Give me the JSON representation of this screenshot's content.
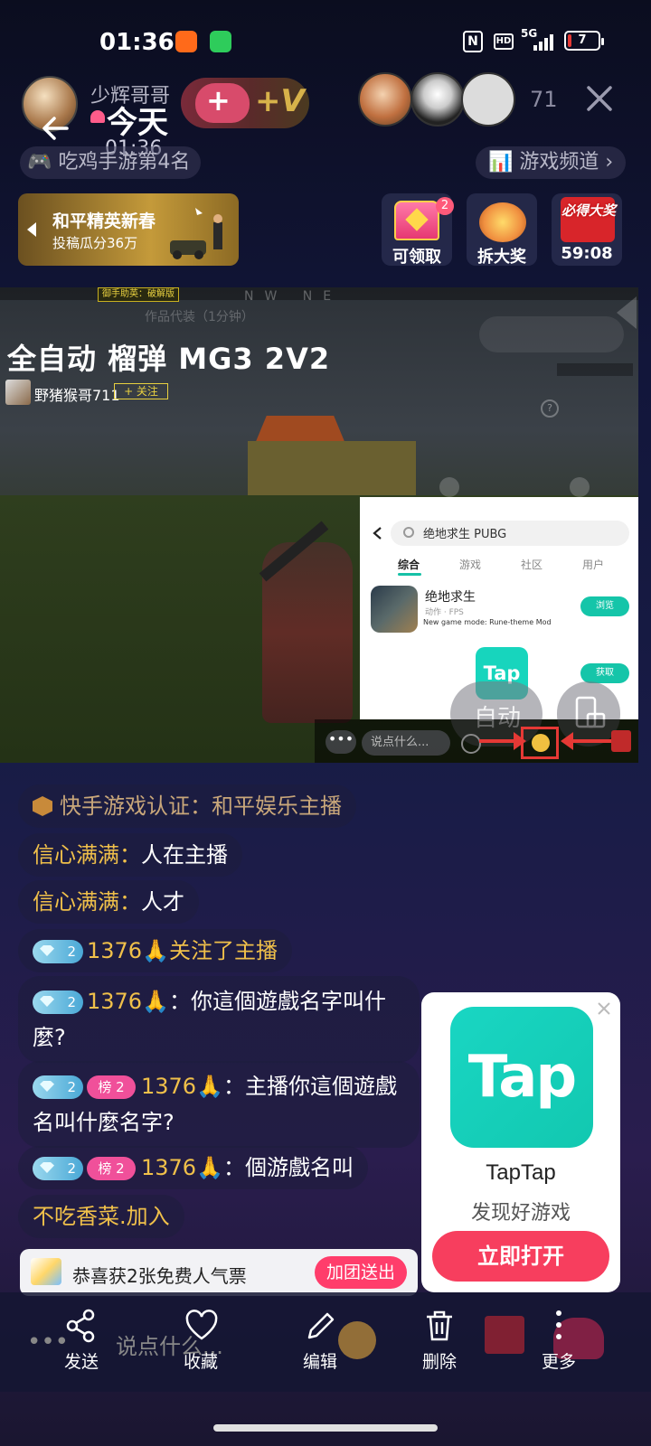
{
  "status_bar": {
    "time": "01:36",
    "network": "5G",
    "hd": "HD",
    "battery": "7",
    "nfc": "N"
  },
  "header": {
    "host_name": "少辉哥哥",
    "title": "今天",
    "subtitle_time": "01:36",
    "viewer_count": "71",
    "heart_plus": "+",
    "v_plus": "+V"
  },
  "tags": {
    "left": "吃鸡手游第4名",
    "right": "游戏频道"
  },
  "promo": {
    "title": "和平精英新春",
    "subtitle": "投稿瓜分36万"
  },
  "gifts": [
    {
      "label": "可领取",
      "badge": "2"
    },
    {
      "label": "拆大奖"
    },
    {
      "label": "59:08",
      "top_text": "必得大奖"
    }
  ],
  "video": {
    "title": "全自动 榴弹 MG3 2V2",
    "streamer": "野猪猴哥711",
    "follow": "+ 关注",
    "hud_tag": "御手助英：破解版",
    "hud_faint": "作品代装（1分钟）",
    "compass": "NW NE"
  },
  "pip": {
    "search_text": "绝地求生 PUBG",
    "tabs": [
      "综合",
      "游戏",
      "社区",
      "用户"
    ],
    "app_name": "绝地求生",
    "app_category": "动作 · FPS",
    "app_desc": "New game mode: Rune-theme Mod",
    "btn_browse": "浏览",
    "btn_get": "获取",
    "tap_label": "Tap"
  },
  "overlay": {
    "auto_label": "自动",
    "input_placeholder": "说点什么...",
    "dots": "•••"
  },
  "chat": {
    "system": "快手游戏认证：和平娱乐主播",
    "lines": [
      {
        "name": "信心满满：",
        "text": "人在主播"
      },
      {
        "name": "信心满满：",
        "text": "人才"
      },
      {
        "level": "2",
        "name": "1376🙏",
        "text": "关注了主播"
      },
      {
        "level": "2",
        "name": "1376🙏",
        "text": "：你這個遊戲名字叫什麼?"
      },
      {
        "level": "2",
        "rank": "榜 2",
        "name": "1376🙏",
        "text": "：主播你這個遊戲名叫什麼名字?"
      },
      {
        "level": "2",
        "rank": "榜 2",
        "name": "1376🙏",
        "text": "：個游戲名叫"
      },
      {
        "name": "不吃香菜.加入"
      }
    ]
  },
  "ad": {
    "icon_text": "Tap",
    "name": "TapTap",
    "subtitle": "发现好游戏",
    "button": "立即打开"
  },
  "ticket": {
    "text": "恭喜获2张免费人气票",
    "button": "加团送出"
  },
  "under_bar": {
    "dots": "•••",
    "placeholder": "说点什么..."
  },
  "actions": [
    {
      "label": "发送",
      "icon": "share-icon"
    },
    {
      "label": "收藏",
      "icon": "heart-icon"
    },
    {
      "label": "编辑",
      "icon": "pencil-icon"
    },
    {
      "label": "删除",
      "icon": "trash-icon"
    },
    {
      "label": "更多",
      "icon": "more-icon"
    }
  ],
  "colors": {
    "accent_pink": "#f73e5e",
    "tap_teal": "#17d5bd",
    "chat_gold": "#f0c04a",
    "arrow_red": "#e53935"
  }
}
